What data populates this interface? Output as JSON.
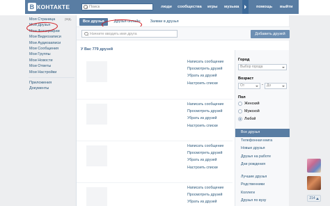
{
  "header": {
    "logo_text": "КОНТАКТЕ",
    "logo_letter": "В",
    "search_placeholder": "Поиск",
    "nav": [
      "люди",
      "сообщества",
      "игры",
      "музыка",
      "помощь",
      "выйти"
    ]
  },
  "left_menu": {
    "edit_label": "ред.",
    "items": [
      "Моя Страница",
      "Мои Друзья",
      "Мои Фотографии",
      "Мои Видеозаписи",
      "Мои Аудиозаписи",
      "Мои Сообщения",
      "Мои Группы",
      "Мои Новости",
      "Мои Ответы",
      "Мои Настройки"
    ],
    "extra": [
      "Приложения",
      "Документы"
    ]
  },
  "tabs": [
    "Все друзья",
    "Друзья онлайн",
    "Заявки в друзья"
  ],
  "filter": {
    "name_placeholder": "Начните вводить имя друга",
    "add_button": "Добавить друзей"
  },
  "friends": {
    "count_text": "У Вас 779 друзей",
    "actions": [
      "Написать сообщение",
      "Просмотреть друзей",
      "Убрать из друзей",
      "Настроить списки"
    ]
  },
  "right_panel": {
    "city_label": "Город",
    "city_placeholder": "Выбор города",
    "age_label": "Возраст",
    "age_from": "От",
    "age_to": "До",
    "sex_label": "Пол",
    "sex_options": [
      "Женский",
      "Мужской",
      "Любой"
    ],
    "sex_selected": "Любой",
    "lists_top": [
      "Все друзья",
      "Телефонная книга",
      "Новые друзья",
      "Друзья на работе",
      "Дни рождения"
    ],
    "lists_bottom": [
      "Лучшие друзья",
      "Родственники",
      "Коллеги",
      "Друзья по вузу"
    ]
  },
  "side": {
    "badge_count": "214"
  },
  "colors": {
    "header_blue": "#597da3",
    "link_blue": "#2b587a",
    "highlight_red": "#d01218",
    "background": "#edeef0"
  }
}
